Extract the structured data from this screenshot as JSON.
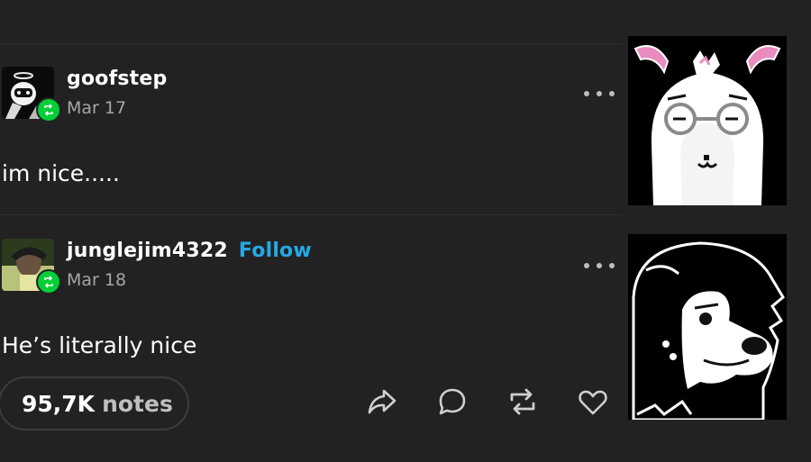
{
  "posts": [
    {
      "username": "goofstep",
      "date": "Mar 17",
      "text": "im nice.....",
      "follow_label": ""
    },
    {
      "username": "junglejim4322",
      "date": "Mar 18",
      "text": "He’s literally nice",
      "follow_label": "Follow"
    }
  ],
  "footer": {
    "notes_count": "95,7K",
    "notes_label": "notes"
  },
  "icons": {
    "share": "share-icon",
    "reply": "reply-icon",
    "reblog": "reblog-icon",
    "like": "heart-icon",
    "more": "more-options-icon"
  },
  "colors": {
    "background": "#222222",
    "follow": "#27a9e6",
    "reblog_badge": "#00cf35"
  }
}
